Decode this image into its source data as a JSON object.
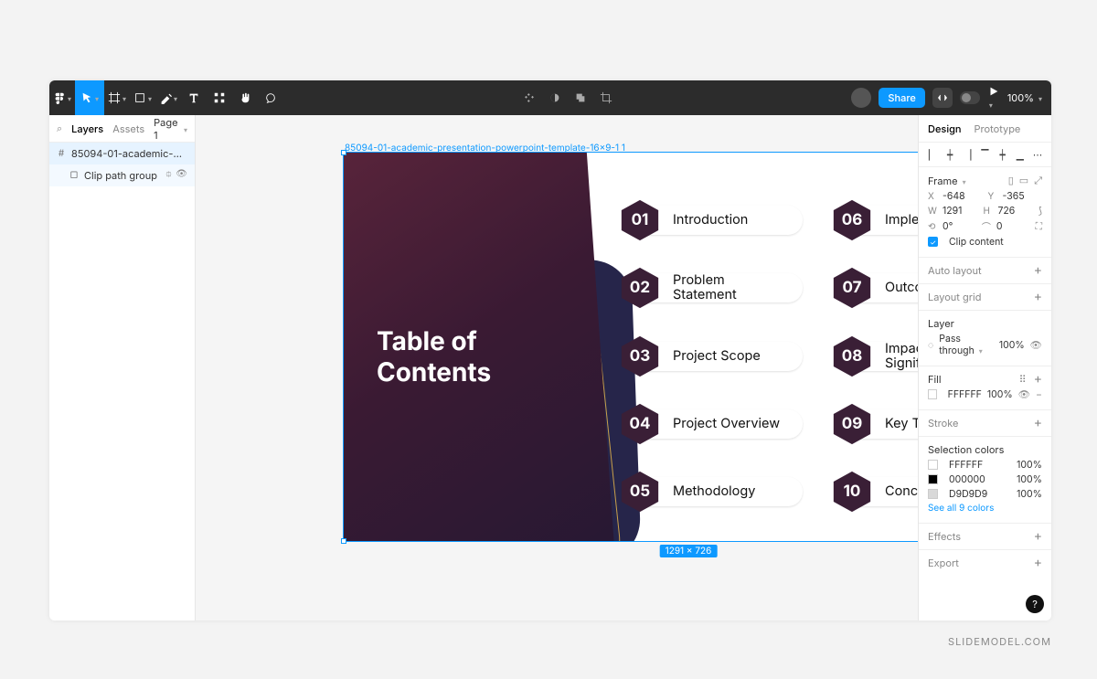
{
  "toolbar": {
    "share": "Share",
    "zoom": "100%"
  },
  "left": {
    "tab_layers": "Layers",
    "tab_assets": "Assets",
    "page": "Page 1",
    "layer_frame": "85094-01-academic-presentatio…",
    "layer_child": "Clip path group"
  },
  "canvas": {
    "frame_label": "85094-01-academic-presentation-powerpoint-template-16x9-1 1",
    "sel_size": "1291 × 726"
  },
  "slide": {
    "title_l1": "Table of",
    "title_l2": "Contents",
    "items": [
      {
        "n": "01",
        "t": "Introduction"
      },
      {
        "n": "02",
        "t": "Problem\nStatement"
      },
      {
        "n": "03",
        "t": "Project Scope"
      },
      {
        "n": "04",
        "t": "Project Overview"
      },
      {
        "n": "05",
        "t": "Methodology"
      },
      {
        "n": "06",
        "t": "Implementation"
      },
      {
        "n": "07",
        "t": "Outcomes"
      },
      {
        "n": "08",
        "t": "Impact and\nSignificance"
      },
      {
        "n": "09",
        "t": "Key Takeaways"
      },
      {
        "n": "10",
        "t": "Conclusion"
      }
    ]
  },
  "right": {
    "tab_design": "Design",
    "tab_proto": "Prototype",
    "frame_label": "Frame",
    "x": "-648",
    "y": "-365",
    "w": "1291",
    "h": "726",
    "rot": "0°",
    "rad": "0",
    "clip": "Clip content",
    "autolayout": "Auto layout",
    "layoutgrid": "Layout grid",
    "layer": "Layer",
    "passthrough": "Pass through",
    "pass_pct": "100%",
    "fill": "Fill",
    "fill_hex": "FFFFFF",
    "fill_pct": "100%",
    "stroke": "Stroke",
    "selcolors": "Selection colors",
    "c1": "FFFFFF",
    "c1p": "100%",
    "c2": "000000",
    "c2p": "100%",
    "c3": "D9D9D9",
    "c3p": "100%",
    "see_all": "See all 9 colors",
    "effects": "Effects",
    "export": "Export"
  },
  "watermark": "SLIDEMODEL.COM"
}
